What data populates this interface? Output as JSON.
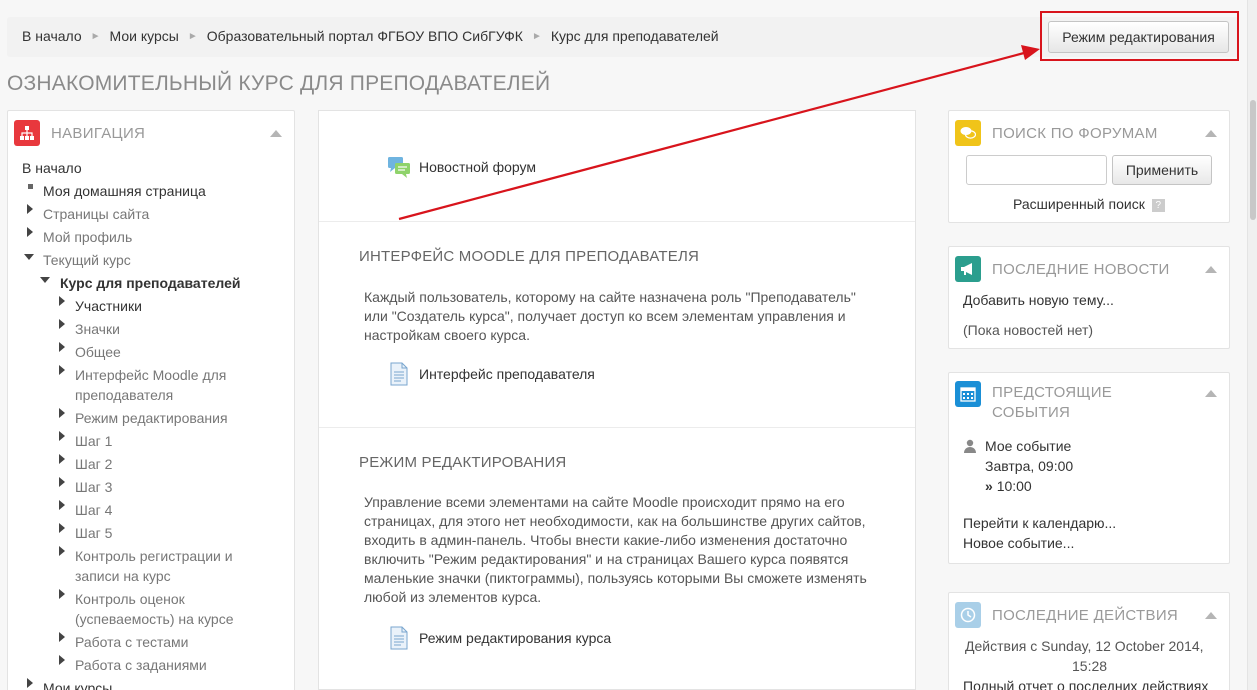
{
  "breadcrumb": [
    "В начало",
    "Мои курсы",
    "Образовательный портал ФГБОУ ВПО СибГУФК",
    "Курс для преподавателей"
  ],
  "breadcrumb_separator": "►",
  "edit_mode_button": "Режим редактирования",
  "page_title": "ОЗНАКОМИТЕЛЬНЫЙ КУРС ДЛЯ ПРЕПОДАВАТЕЛЕЙ",
  "navigation": {
    "title": "НАВИГАЦИЯ",
    "icon": "sitemap-icon",
    "icon_color": "#e8383d",
    "home": "В начало",
    "dashboard": "Моя домашняя страница",
    "site_pages": "Страницы сайта",
    "profile": "Мой профиль",
    "current_course": "Текущий курс",
    "course": "Курс для преподавателей",
    "course_items": [
      {
        "label": "Участники",
        "bold_style": false
      },
      {
        "label": "Значки"
      },
      {
        "label": "Общее"
      },
      {
        "label": "Интерфейс Moodle для"
      },
      {
        "label": "преподавателя"
      },
      {
        "label": "Режим редактирования"
      },
      {
        "label": "Шаг 1"
      },
      {
        "label": "Шаг 2"
      },
      {
        "label": "Шаг 3"
      },
      {
        "label": "Шаг 4"
      },
      {
        "label": "Шаг 5"
      },
      {
        "label": "Контроль регистрации и"
      },
      {
        "label": "записи на курс"
      },
      {
        "label": "Контроль оценок"
      },
      {
        "label": "(успеваемость) на курсе"
      },
      {
        "label": "Работа с тестами"
      },
      {
        "label": "Работа с заданиями"
      }
    ],
    "my_courses": "Мои курсы"
  },
  "main": {
    "news_forum": "Новостной форум",
    "sections": [
      {
        "title": "ИНТЕРФЕЙС MOODLE ДЛЯ ПРЕПОДАВАТЕЛЯ",
        "summary_lines": [
          "Каждый пользователь, которому на сайте назначена роль \"Преподаватель\"",
          "или \"Создатель курса\", получает доступ ко всем элементам управления и",
          "настройкам своего курса."
        ],
        "resource": "Интерфейс преподавателя"
      },
      {
        "title": "РЕЖИМ РЕДАКТИРОВАНИЯ",
        "summary_lines": [
          "Управление всеми элементами на сайте Moodle происходит прямо на его",
          "страницах, для этого нет необходимости, как на большинстве других сайтов,",
          "входить в админ-панель. Чтобы внести какие-либо изменения достаточно",
          "включить \"Режим редактирования\" и на страницах Вашего курса появятся",
          "маленькие значки (пиктограммы), пользуясь которыми Вы сможете изменять",
          "любой из элементов курса."
        ],
        "resource": "Режим редактирования курса"
      }
    ]
  },
  "forum_search": {
    "title": "ПОИСК ПО ФОРУМАМ",
    "icon": "chat-icon",
    "icon_color": "#f0c419",
    "input_value": "",
    "apply_button": "Применить",
    "advanced": "Расширенный поиск",
    "help": "?"
  },
  "latest_news": {
    "title": "ПОСЛЕДНИЕ НОВОСТИ",
    "icon": "megaphone-icon",
    "icon_color": "#2b9e8e",
    "add_topic": "Добавить новую тему...",
    "empty": "(Пока новостей нет)"
  },
  "upcoming_events": {
    "title_line1": "ПРЕДСТОЯЩИЕ",
    "title_line2": "СОБЫТИЯ",
    "icon": "calendar-icon",
    "icon_color": "#1a8fd6",
    "event_name": "Мое событие",
    "event_date": "Завтра, 09:00",
    "event_end_marker": "»",
    "event_end": "10:00",
    "go_calendar": "Перейти к календарю...",
    "new_event": "Новое событие..."
  },
  "recent_activity": {
    "title": "ПОСЛЕДНИЕ ДЕЙСТВИЯ",
    "icon": "clock-icon",
    "icon_color": "#a9cfe8",
    "since_line1": "Действия с Sunday, 12 October 2014,",
    "since_line2": "15:28",
    "full_report": "Полный отчет о последних действиях"
  }
}
